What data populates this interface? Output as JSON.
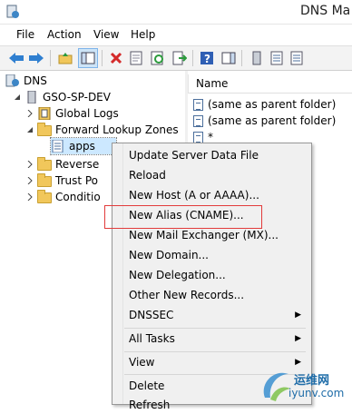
{
  "window": {
    "title": "DNS Ma"
  },
  "menubar": {
    "items": [
      "File",
      "Action",
      "View",
      "Help"
    ]
  },
  "toolbar": {
    "buttons": [
      "back-arrow-icon",
      "forward-arrow-icon",
      "up-folder-icon",
      "show-hide-tree-icon",
      "delete-icon",
      "properties-icon",
      "refresh-icon",
      "export-icon",
      "help-icon",
      "action-pane-icon",
      "server-icon",
      "zone-icon",
      "record-icon"
    ]
  },
  "tree": {
    "root": "DNS",
    "server": "GSO-SP-DEV",
    "global_logs": "Global Logs",
    "forward_zones": "Forward Lookup Zones",
    "apps_zone": "apps",
    "reverse_zones": "Reverse",
    "trust_points": "Trust Po",
    "conditional": "Conditio"
  },
  "list": {
    "column_name": "Name",
    "rows": [
      "(same as parent folder)",
      "(same as parent folder)",
      "*"
    ]
  },
  "context_menu": {
    "items": [
      "Update Server Data File",
      "Reload",
      "New Host (A or AAAA)...",
      "New Alias (CNAME)...",
      "New Mail Exchanger (MX)...",
      "New Domain...",
      "New Delegation...",
      "Other New Records...",
      "DNSSEC",
      "All Tasks",
      "View",
      "Delete",
      "Refresh"
    ],
    "highlighted": "New Alias (CNAME)..."
  },
  "watermark": {
    "line1": "运维网",
    "line2": "iyunv.com"
  },
  "colors": {
    "highlight": "#e23b3b",
    "selection": "#cce8ff",
    "accent": "#1e6ca8"
  }
}
